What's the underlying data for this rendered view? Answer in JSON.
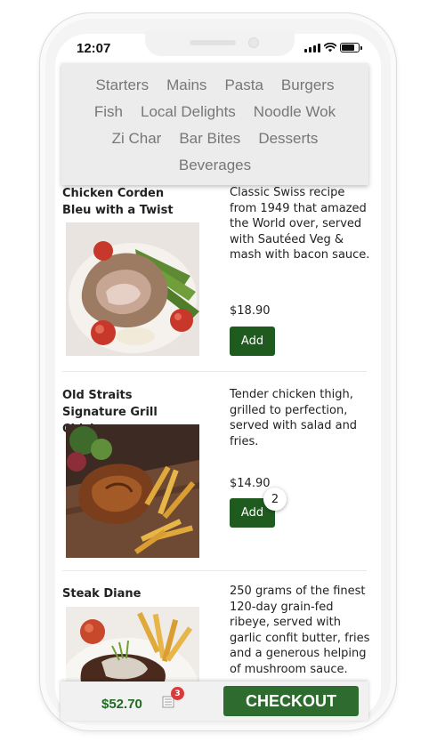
{
  "status_bar": {
    "time": "12:07"
  },
  "categories": [
    "Starters",
    "Mains",
    "Pasta",
    "Burgers",
    "Fish",
    "Local Delights",
    "Noodle Wok",
    "Zi Char",
    "Bar Bites",
    "Desserts",
    "Beverages"
  ],
  "menu_items": [
    {
      "name": "Chicken Corden Bleu with a Twist",
      "description": "Classic Swiss recipe from 1949 that amazed the World over, served with Sautéed Veg & mash with bacon sauce.",
      "price": "$18.90",
      "add_label": "Add"
    },
    {
      "name": "Old Straits Signature Grill Chicken",
      "description": "Tender chicken thigh, grilled to perfection, served with salad and fries.",
      "price": "$14.90",
      "add_label": "Add",
      "quantity": "2"
    },
    {
      "name": "Steak Diane",
      "description": "250 grams of the finest 120-day grain-fed ribeye, served with garlic confit butter, fries and a generous helping of mushroom sauce."
    }
  ],
  "cart": {
    "total": "$52.70",
    "item_count": "3",
    "checkout_label": "CHECKOUT"
  },
  "colors": {
    "button_green": "#1f5b1f",
    "checkout_green": "#2e6b2e",
    "total_green": "#1f6b1f",
    "badge_red": "#d63c3c",
    "category_text": "#777777"
  }
}
